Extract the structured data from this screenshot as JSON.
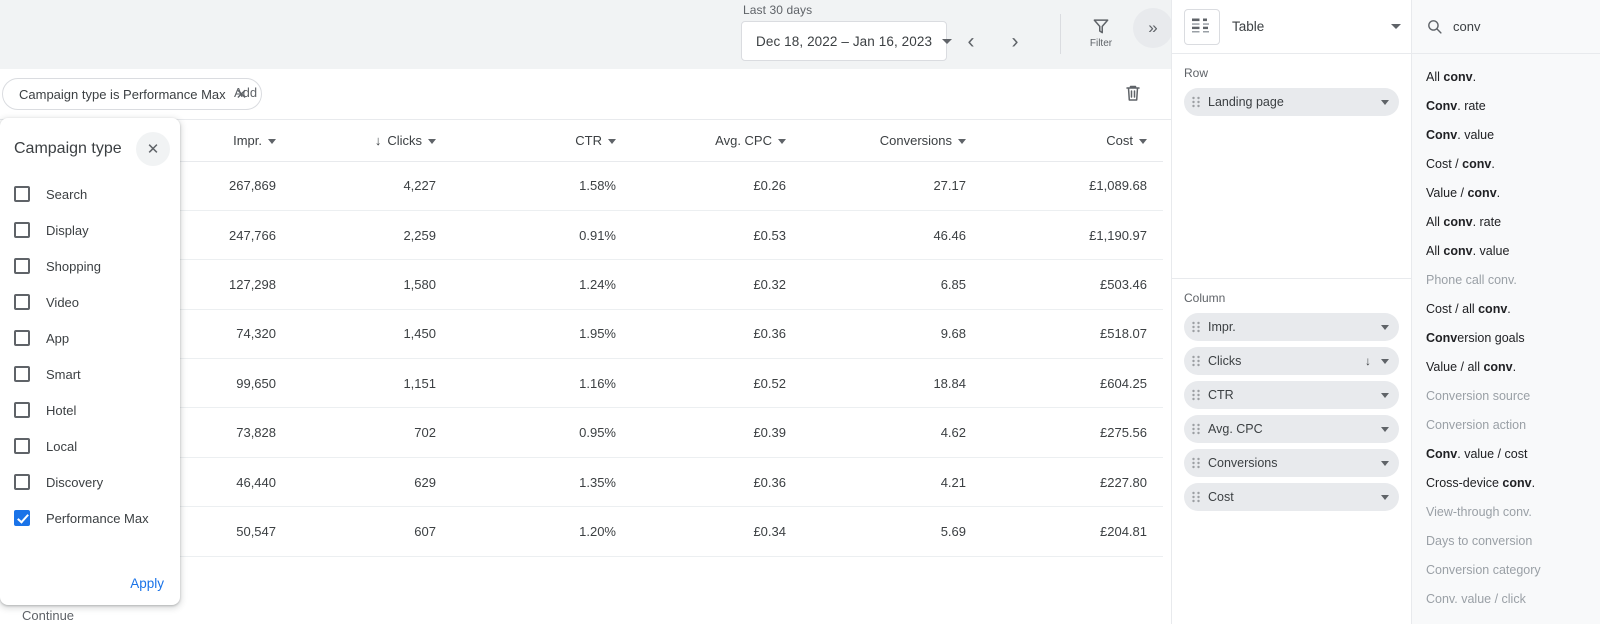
{
  "toolbar": {
    "date_caption": "Last 30 days",
    "date_range": "Dec 18, 2022 – Jan 16, 2023",
    "prev_arrow": "‹",
    "next_arrow": "›",
    "filter_label": "Filter",
    "expand_label": "»"
  },
  "filter_bar": {
    "chip_label": "Campaign type is Performance Max",
    "chip_close": "✕",
    "add_label": "Add"
  },
  "campaign_popup": {
    "title": "Campaign type",
    "close": "✕",
    "apply_label": "Apply",
    "options": [
      {
        "label": "Search",
        "checked": false
      },
      {
        "label": "Display",
        "checked": false
      },
      {
        "label": "Shopping",
        "checked": false
      },
      {
        "label": "Video",
        "checked": false
      },
      {
        "label": "App",
        "checked": false
      },
      {
        "label": "Smart",
        "checked": false
      },
      {
        "label": "Hotel",
        "checked": false
      },
      {
        "label": "Local",
        "checked": false
      },
      {
        "label": "Discovery",
        "checked": false
      },
      {
        "label": "Performance Max",
        "checked": true
      }
    ]
  },
  "behind_text": "Continue",
  "table": {
    "columns": [
      {
        "label": "",
        "sorted": false
      },
      {
        "label": "Impr.",
        "sorted": false
      },
      {
        "label": "Clicks",
        "sorted": true,
        "sort_arrow": "↓"
      },
      {
        "label": "CTR",
        "sorted": false
      },
      {
        "label": "Avg. CPC",
        "sorted": false
      },
      {
        "label": "Conversions",
        "sorted": false
      },
      {
        "label": "Cost",
        "sorted": false
      }
    ],
    "rows": [
      {
        "impr": "267,869",
        "clicks": "4,227",
        "ctr": "1.58%",
        "cpc": "£0.26",
        "conversions": "27.17",
        "cost": "£1,089.68"
      },
      {
        "impr": "247,766",
        "clicks": "2,259",
        "ctr": "0.91%",
        "cpc": "£0.53",
        "conversions": "46.46",
        "cost": "£1,190.97"
      },
      {
        "impr": "127,298",
        "clicks": "1,580",
        "ctr": "1.24%",
        "cpc": "£0.32",
        "conversions": "6.85",
        "cost": "£503.46"
      },
      {
        "impr": "74,320",
        "clicks": "1,450",
        "ctr": "1.95%",
        "cpc": "£0.36",
        "conversions": "9.68",
        "cost": "£518.07"
      },
      {
        "impr": "99,650",
        "clicks": "1,151",
        "ctr": "1.16%",
        "cpc": "£0.52",
        "conversions": "18.84",
        "cost": "£604.25"
      },
      {
        "impr": "73,828",
        "clicks": "702",
        "ctr": "0.95%",
        "cpc": "£0.39",
        "conversions": "4.62",
        "cost": "£275.56"
      },
      {
        "impr": "46,440",
        "clicks": "629",
        "ctr": "1.35%",
        "cpc": "£0.36",
        "conversions": "4.21",
        "cost": "£227.80"
      },
      {
        "impr": "50,547",
        "clicks": "607",
        "ctr": "1.20%",
        "cpc": "£0.34",
        "conversions": "5.69",
        "cost": "£204.81"
      }
    ]
  },
  "config_panel": {
    "viz_type": "Table",
    "row_section_title": "Row",
    "row_fields": [
      {
        "label": "Landing page"
      }
    ],
    "column_section_title": "Column",
    "column_fields": [
      {
        "label": "Impr.",
        "sort": ""
      },
      {
        "label": "Clicks",
        "sort": "↓"
      },
      {
        "label": "CTR",
        "sort": ""
      },
      {
        "label": "Avg. CPC",
        "sort": ""
      },
      {
        "label": "Conversions",
        "sort": ""
      },
      {
        "label": "Cost",
        "sort": ""
      }
    ]
  },
  "search_panel": {
    "query": "conv",
    "results": [
      {
        "pre": "All ",
        "match": "conv",
        "post": ".",
        "enabled": true
      },
      {
        "pre": "",
        "match": "Conv",
        "post": ". rate",
        "enabled": true
      },
      {
        "pre": "",
        "match": "Conv",
        "post": ". value",
        "enabled": true
      },
      {
        "pre": "Cost / ",
        "match": "conv",
        "post": ".",
        "enabled": true
      },
      {
        "pre": "Value / ",
        "match": "conv",
        "post": ".",
        "enabled": true
      },
      {
        "pre": "All ",
        "match": "conv",
        "post": ". rate",
        "enabled": true
      },
      {
        "pre": "All ",
        "match": "conv",
        "post": ". value",
        "enabled": true
      },
      {
        "pre": "Phone call ",
        "match": "conv",
        "post": ".",
        "enabled": false
      },
      {
        "pre": "Cost / all ",
        "match": "conv",
        "post": ".",
        "enabled": true
      },
      {
        "pre": "",
        "match": "Conv",
        "post": "ersion goals",
        "enabled": true
      },
      {
        "pre": "Value / all ",
        "match": "conv",
        "post": ".",
        "enabled": true
      },
      {
        "pre": "",
        "match": "Conv",
        "post": "ersion source",
        "enabled": false
      },
      {
        "pre": "",
        "match": "Conv",
        "post": "ersion action",
        "enabled": false
      },
      {
        "pre": "",
        "match": "Conv",
        "post": ". value / cost",
        "enabled": true
      },
      {
        "pre": "Cross-device ",
        "match": "conv",
        "post": ".",
        "enabled": true
      },
      {
        "pre": "View-through ",
        "match": "conv",
        "post": ".",
        "enabled": false
      },
      {
        "pre": "Days to ",
        "match": "conv",
        "post": "ersion",
        "enabled": false
      },
      {
        "pre": "",
        "match": "Conv",
        "post": "ersion category",
        "enabled": false
      },
      {
        "pre": "",
        "match": "Conv",
        "post": ". value / click",
        "enabled": false
      }
    ]
  }
}
